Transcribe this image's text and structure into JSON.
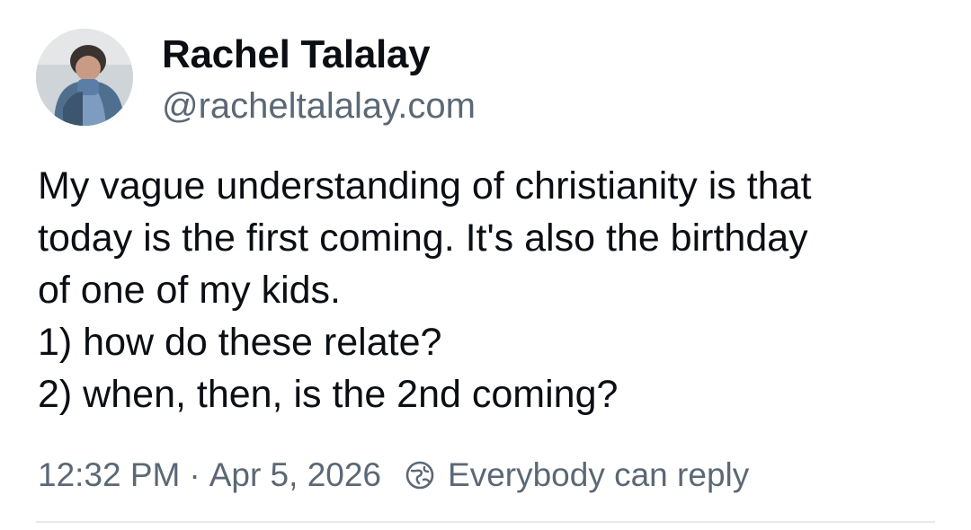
{
  "author": {
    "display_name": "Rachel Talalay",
    "handle": "@racheltalalay.com"
  },
  "post": {
    "text_lines": [
      "My vague understanding of christianity is that",
      "today is the first coming. It's also the birthday",
      "of one of my kids.",
      "1) how do these relate?",
      "2) when, then, is the 2nd coming?"
    ]
  },
  "meta": {
    "time": "12:32 PM",
    "separator": "·",
    "date": "Apr 5, 2026",
    "reply_setting_icon": "globe-reply-icon",
    "reply_setting": "Everybody can reply"
  },
  "colors": {
    "text": "#0b0f14",
    "secondary_text": "#5b6875",
    "divider": "#e6e9ec",
    "background": "#ffffff"
  }
}
